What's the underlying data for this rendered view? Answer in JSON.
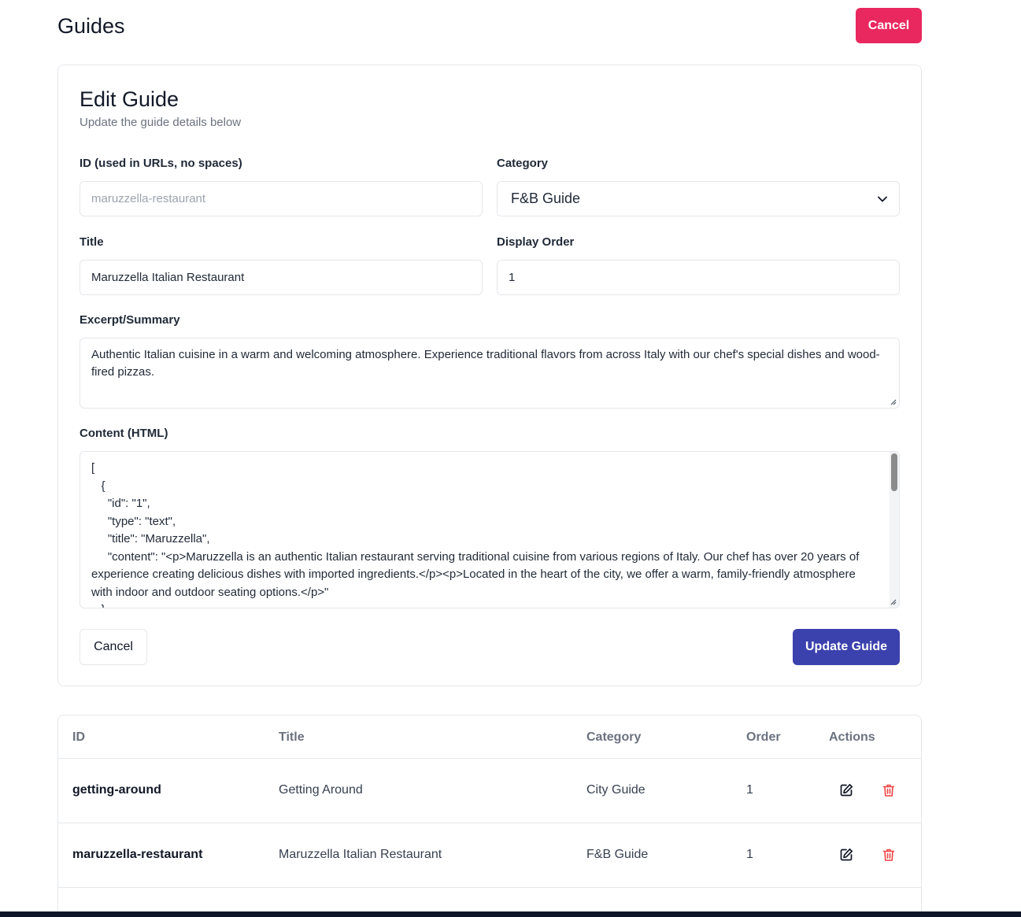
{
  "header": {
    "title": "Guides",
    "cancel_label": "Cancel"
  },
  "form": {
    "title": "Edit Guide",
    "subtitle": "Update the guide details below",
    "id_field": {
      "label": "ID (used in URLs, no spaces)",
      "value": "maruzzella-restaurant"
    },
    "category_field": {
      "label": "Category",
      "value": "F&B Guide"
    },
    "title_field": {
      "label": "Title",
      "value": "Maruzzella Italian Restaurant"
    },
    "order_field": {
      "label": "Display Order",
      "value": "1"
    },
    "excerpt_field": {
      "label": "Excerpt/Summary",
      "value": "Authentic Italian cuisine in a warm and welcoming atmosphere. Experience traditional flavors from across Italy with our chef's special dishes and wood-fired pizzas."
    },
    "content_field": {
      "label": "Content (HTML)",
      "value": "[\n   {\n     \"id\": \"1\",\n     \"type\": \"text\",\n     \"title\": \"Maruzzella\",\n     \"content\": \"<p>Maruzzella is an authentic Italian restaurant serving traditional cuisine from various regions of Italy. Our chef has over 20 years of experience creating delicious dishes with imported ingredients.</p><p>Located in the heart of the city, we offer a warm, family-friendly atmosphere with indoor and outdoor seating options.</p>\"\n   },"
    },
    "cancel_label": "Cancel",
    "submit_label": "Update Guide"
  },
  "table": {
    "headers": {
      "id": "ID",
      "title": "Title",
      "category": "Category",
      "order": "Order",
      "actions": "Actions"
    },
    "rows": [
      {
        "id": "getting-around",
        "title": "Getting Around",
        "category": "City Guide",
        "order": "1",
        "icons": [
          "edit-icon",
          "trash-icon"
        ]
      },
      {
        "id": "maruzzella-restaurant",
        "title": "Maruzzella Italian Restaurant",
        "category": "F&B Guide",
        "order": "1",
        "icons": [
          "edit-icon",
          "trash-icon"
        ]
      }
    ]
  },
  "colors": {
    "danger": "#e9285f",
    "primary": "#3b41ad",
    "delete_icon": "#ef4444"
  }
}
